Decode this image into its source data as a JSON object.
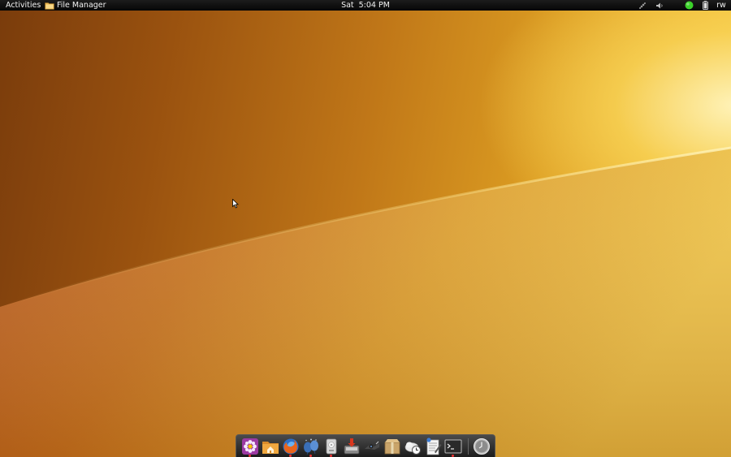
{
  "top_panel": {
    "activities_label": "Activities",
    "app_menu": {
      "label": "File Manager",
      "icon": "file-manager-icon"
    },
    "clock": {
      "day": "Sat",
      "time": "5:04 PM"
    },
    "tray": {
      "network_icon": "network-icon",
      "volume_icon": "volume-icon",
      "status_icon": "status-online-icon",
      "status_color": "#3bd12a",
      "battery_icon": "battery-icon",
      "user": "rw"
    }
  },
  "desktop": {
    "wallpaper_colors": [
      "#7a3c0c",
      "#c07718",
      "#f4c84a",
      "#fff2c0"
    ]
  },
  "dock": {
    "items": [
      {
        "name": "gnome-tweak",
        "icon": "settings-flower-icon",
        "running": true
      },
      {
        "name": "home-folder",
        "icon": "home-folder-icon",
        "running": false
      },
      {
        "name": "firefox",
        "icon": "firefox-icon",
        "running": true
      },
      {
        "name": "empathy",
        "icon": "chat-balloons-icon",
        "running": true
      },
      {
        "name": "disk-utility",
        "icon": "hard-disk-icon",
        "running": true
      },
      {
        "name": "software-center",
        "icon": "installer-icon",
        "running": false
      },
      {
        "name": "shotwell",
        "icon": "photo-manager-icon",
        "running": false
      },
      {
        "name": "archive-manager",
        "icon": "archive-icon",
        "running": false
      },
      {
        "name": "backup",
        "icon": "backup-clock-icon",
        "running": false
      },
      {
        "name": "text-editor",
        "icon": "text-editor-icon",
        "running": false
      },
      {
        "name": "terminal",
        "icon": "terminal-icon",
        "running": true
      },
      {
        "name": "clock",
        "icon": "clock-icon",
        "running": false
      }
    ]
  }
}
